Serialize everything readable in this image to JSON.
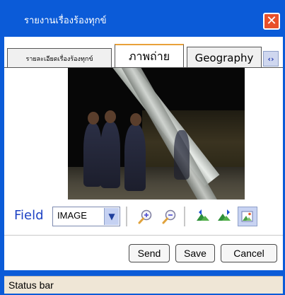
{
  "window": {
    "title": "รายงานเรื่องร้องทุกข์",
    "close_icon": "close-icon"
  },
  "tabs": [
    {
      "label": "รายละเอียดเรื่องร้องทุกข์",
      "active": false
    },
    {
      "label": "ภาพถ่าย",
      "active": true
    },
    {
      "label": "Geography",
      "active": false
    }
  ],
  "tab_scroll_icon": "tab-scroll-arrows-icon",
  "photo": {
    "description_icon": "photo-image"
  },
  "toolbar": {
    "field_label": "Field",
    "field_value": "IMAGE",
    "icons": [
      "zoom-in-icon",
      "zoom-out-icon",
      "prev-image-icon",
      "next-image-icon",
      "add-image-icon"
    ]
  },
  "actions": {
    "send_label": "Send",
    "save_label": "Save",
    "cancel_label": "Cancel"
  },
  "status": {
    "text": "Status bar"
  },
  "colors": {
    "window_blue": "#0b5bd8",
    "tab_accent": "#e8a13a",
    "field_label": "#1d42c4",
    "close_red": "#e8502a",
    "status_bg": "#efe6d6"
  }
}
